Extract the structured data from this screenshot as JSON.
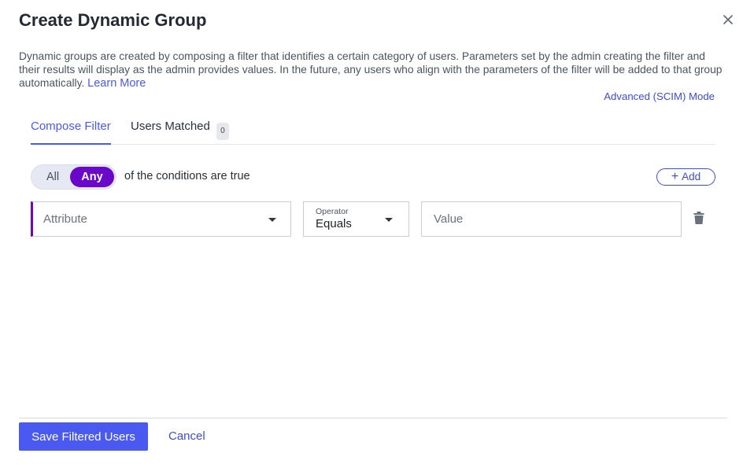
{
  "dialog": {
    "title": "Create Dynamic Group",
    "description": "Dynamic groups are created by composing a filter that identifies a certain category of users. Parameters set by the admin creating the filter and their results will display as the admin provides values. In the future, any users who align with the parameters of the filter will be added to that group automatically.",
    "learn_more": "Learn More",
    "advanced_mode": "Advanced (SCIM) Mode"
  },
  "tabs": [
    {
      "label": "Compose Filter",
      "active": true
    },
    {
      "label": "Users Matched",
      "badge": "0",
      "active": false
    }
  ],
  "filter": {
    "match_options": [
      "All",
      "Any"
    ],
    "selected_match": "Any",
    "conditions_text": "of the conditions are true",
    "add_label": "Add",
    "attribute_placeholder": "Attribute",
    "operator_label": "Operator",
    "operator_value": "Equals",
    "value_placeholder": "Value"
  },
  "footer": {
    "save_label": "Save Filtered Users",
    "cancel_label": "Cancel"
  },
  "colors": {
    "primary": "#4a5af0",
    "accent_purple": "#6a08c9"
  },
  "icons": [
    "close-icon",
    "plus-icon",
    "chevron-down-icon",
    "trash-icon"
  ]
}
